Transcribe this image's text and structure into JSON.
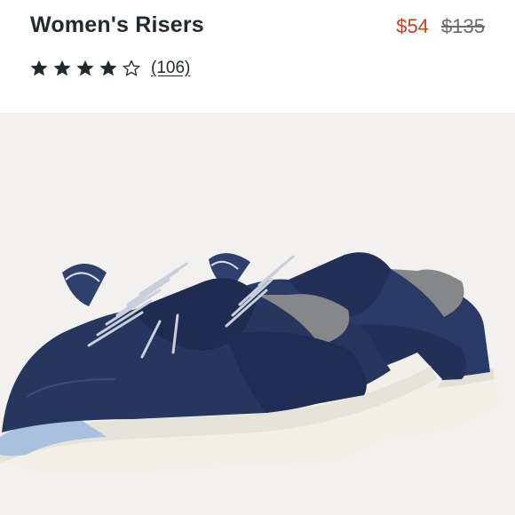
{
  "product": {
    "title": "Women's Risers",
    "sale_price": "$54",
    "original_price": "$135",
    "rating": 4,
    "rating_max": 5,
    "review_count": "(106)"
  },
  "image": {
    "subject": "navy-blue-sneakers",
    "colors": {
      "upper": "#27365f",
      "sole": "#f1efe6",
      "outsole": "#a9c0df",
      "lining": "#8a8c8e",
      "laces": "#c9d0dc",
      "background": "#f2f1ef"
    }
  },
  "colors": {
    "sale": "#c2441f",
    "text": "#212a2f",
    "muted": "#6b6b6b"
  }
}
